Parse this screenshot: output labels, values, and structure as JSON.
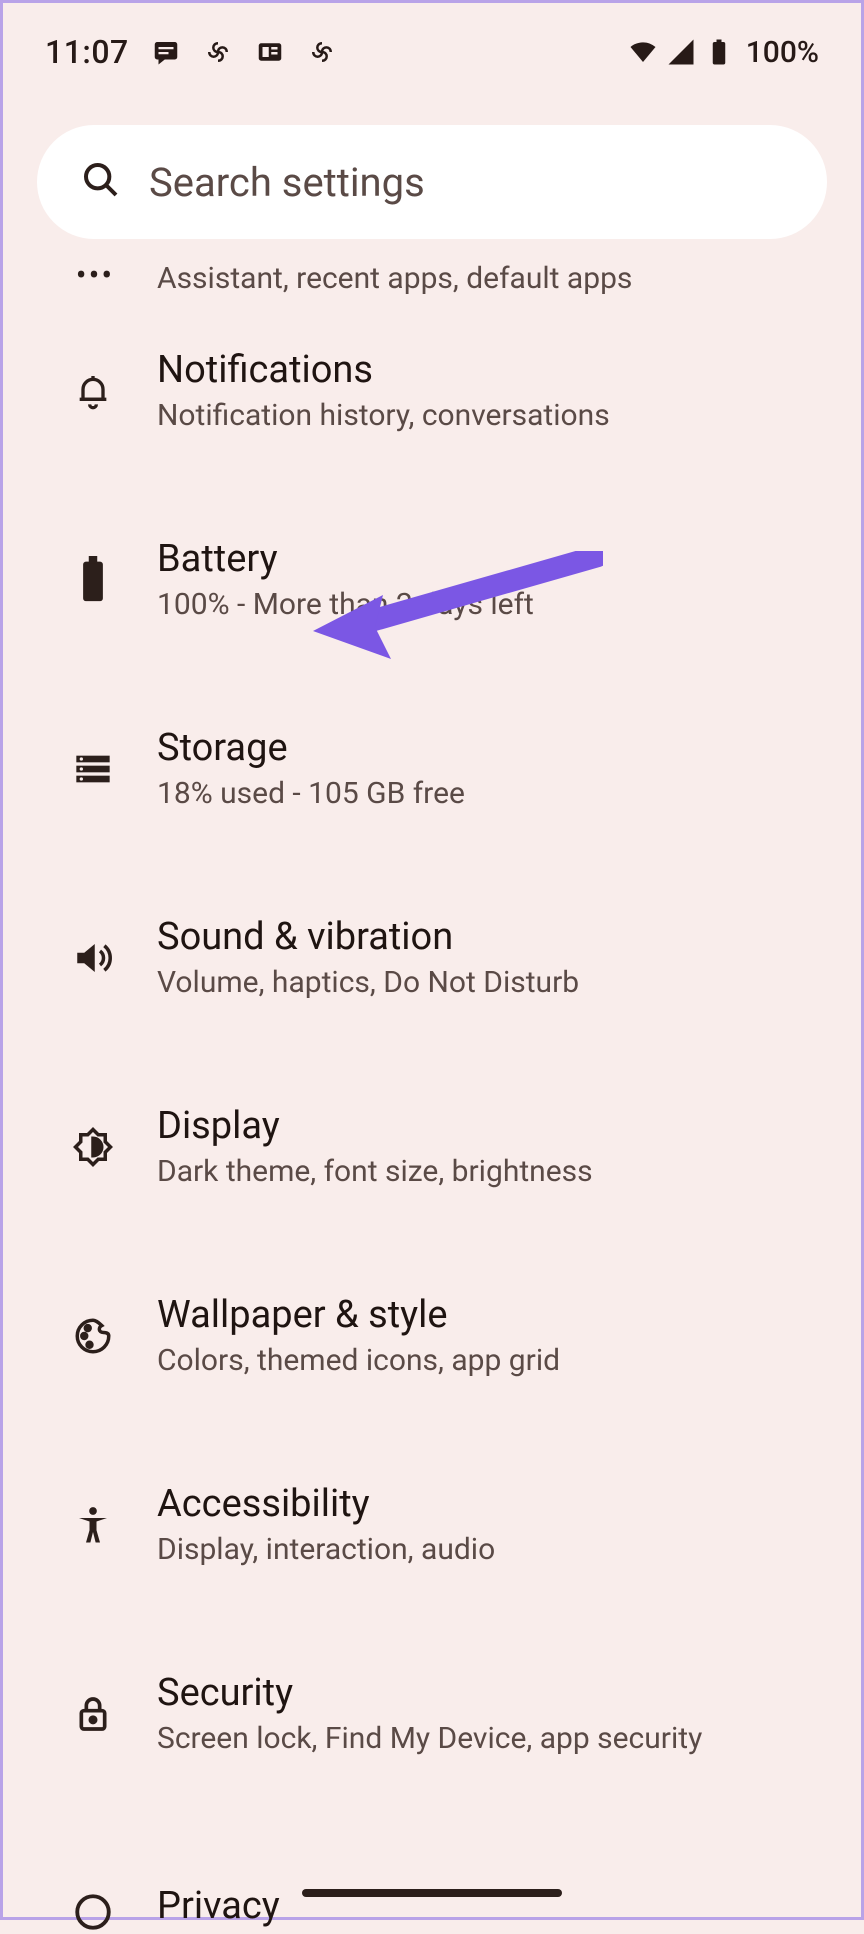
{
  "status_bar": {
    "time": "11:07",
    "battery_text": "100%"
  },
  "search": {
    "placeholder": "Search settings"
  },
  "partial": {
    "subtitle": "Assistant, recent apps, default apps"
  },
  "items": [
    {
      "title": "Notifications",
      "subtitle": "Notification history, conversations"
    },
    {
      "title": "Battery",
      "subtitle": "100% - More than 2 days left"
    },
    {
      "title": "Storage",
      "subtitle": "18% used - 105 GB free"
    },
    {
      "title": "Sound & vibration",
      "subtitle": "Volume, haptics, Do Not Disturb"
    },
    {
      "title": "Display",
      "subtitle": "Dark theme, font size, brightness"
    },
    {
      "title": "Wallpaper & style",
      "subtitle": "Colors, themed icons, app grid"
    },
    {
      "title": "Accessibility",
      "subtitle": "Display, interaction, audio"
    },
    {
      "title": "Security",
      "subtitle": "Screen lock, Find My Device, app security"
    },
    {
      "title": "Privacy",
      "subtitle": ""
    }
  ],
  "annotation": {
    "arrow_color": "#7b57e4"
  }
}
